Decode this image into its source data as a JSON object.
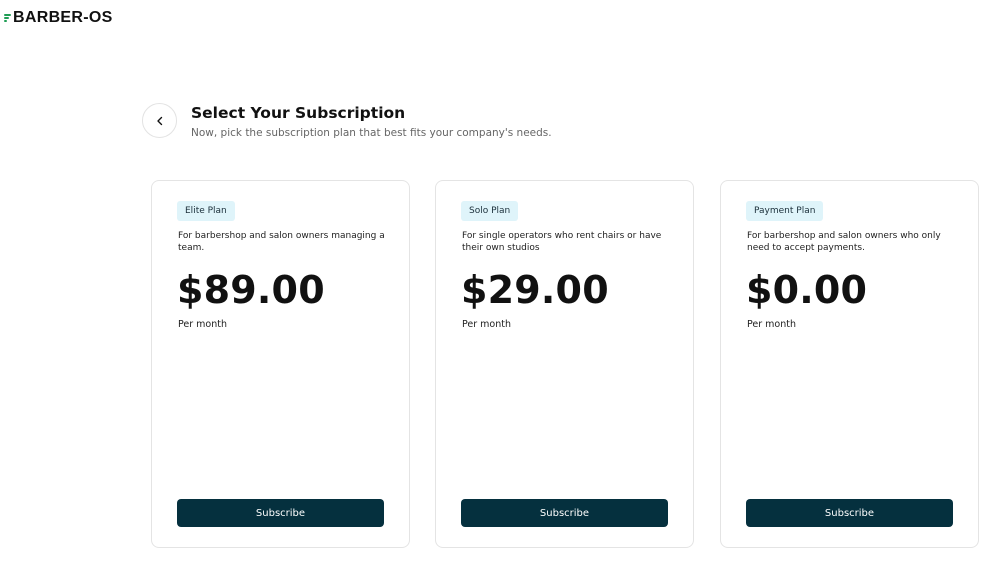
{
  "app": {
    "logo_text": "BARBER-OS",
    "brand_color": "#1f9d55"
  },
  "header": {
    "back_icon": "chevron-left-icon",
    "title": "Select Your Subscription",
    "subtitle": "Now, pick the subscription plan that best fits your company's needs."
  },
  "plans": [
    {
      "badge": "Elite Plan",
      "description": "For barbershop and salon owners managing a team.",
      "price": "$89.00",
      "period": "Per month",
      "button_label": "Subscribe"
    },
    {
      "badge": "Solo Plan",
      "description": "For single operators who rent chairs or have their own studios",
      "price": "$29.00",
      "period": "Per month",
      "button_label": "Subscribe"
    },
    {
      "badge": "Payment Plan",
      "description": "For barbershop and salon owners who only need to accept payments.",
      "price": "$0.00",
      "period": "Per month",
      "button_label": "Subscribe"
    }
  ],
  "colors": {
    "button_bg": "#05303e",
    "badge_bg": "#dff4fa",
    "card_border": "#e4e4e4"
  }
}
